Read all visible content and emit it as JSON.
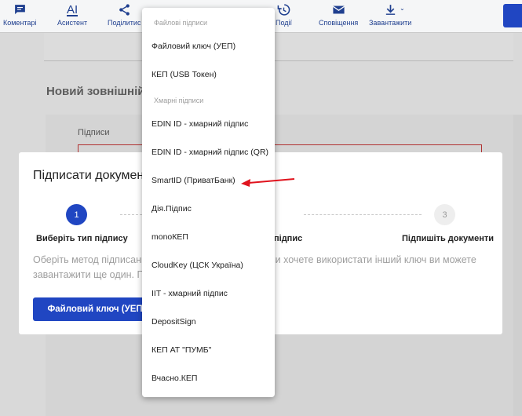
{
  "toolbar": {
    "items": [
      {
        "label": "Коментарі",
        "icon": "comment-icon"
      },
      {
        "label": "Асистент",
        "icon": "ai-icon"
      },
      {
        "label": "Поділитис",
        "icon": "share-icon"
      },
      {
        "label": "Події",
        "icon": "history-icon"
      },
      {
        "label": "Сповіщення",
        "icon": "mail-icon"
      },
      {
        "label": "Завантажити",
        "icon": "download-icon"
      }
    ],
    "ai_glyph": "AI"
  },
  "background": {
    "heading": "Новий зовнішній",
    "sign_label": "Підписи"
  },
  "modal": {
    "title": "Підписати докумен",
    "steps": [
      {
        "number": "1",
        "label": "Виберіть тип підпису"
      },
      {
        "number": "",
        "label": "підпис"
      },
      {
        "number": "3",
        "label": "Підпишіть документи"
      }
    ],
    "desc_left_1": "Оберіть метод підписанн",
    "desc_right_1": "ви хочете використати інший ключ ви можете",
    "desc_left_2": "завантажити ще один. П",
    "button": "Файловий ключ (УЕП)"
  },
  "menu": {
    "group_file": "Файлові підписи",
    "group_cloud": "Хмарні підписи",
    "file_items": [
      "Файловий ключ (УЕП)",
      "КЕП (USB Токен)"
    ],
    "cloud_items": [
      "EDIN ID - хмарний підпис",
      "EDIN ID - хмарний підпис (QR)",
      "SmartID (ПриватБанк)",
      "Дія.Підпис",
      "monoКЕП",
      "CloudKey (ЦСК Україна)",
      "IIT - хмарний підпис",
      "DepositSign",
      "КЕП АТ \"ПУМБ\"",
      "Вчасно.КЕП"
    ]
  },
  "colors": {
    "primary": "#2046c2",
    "toolbar_icon": "#1f3f8f",
    "annotation_arrow": "#e0141e"
  }
}
